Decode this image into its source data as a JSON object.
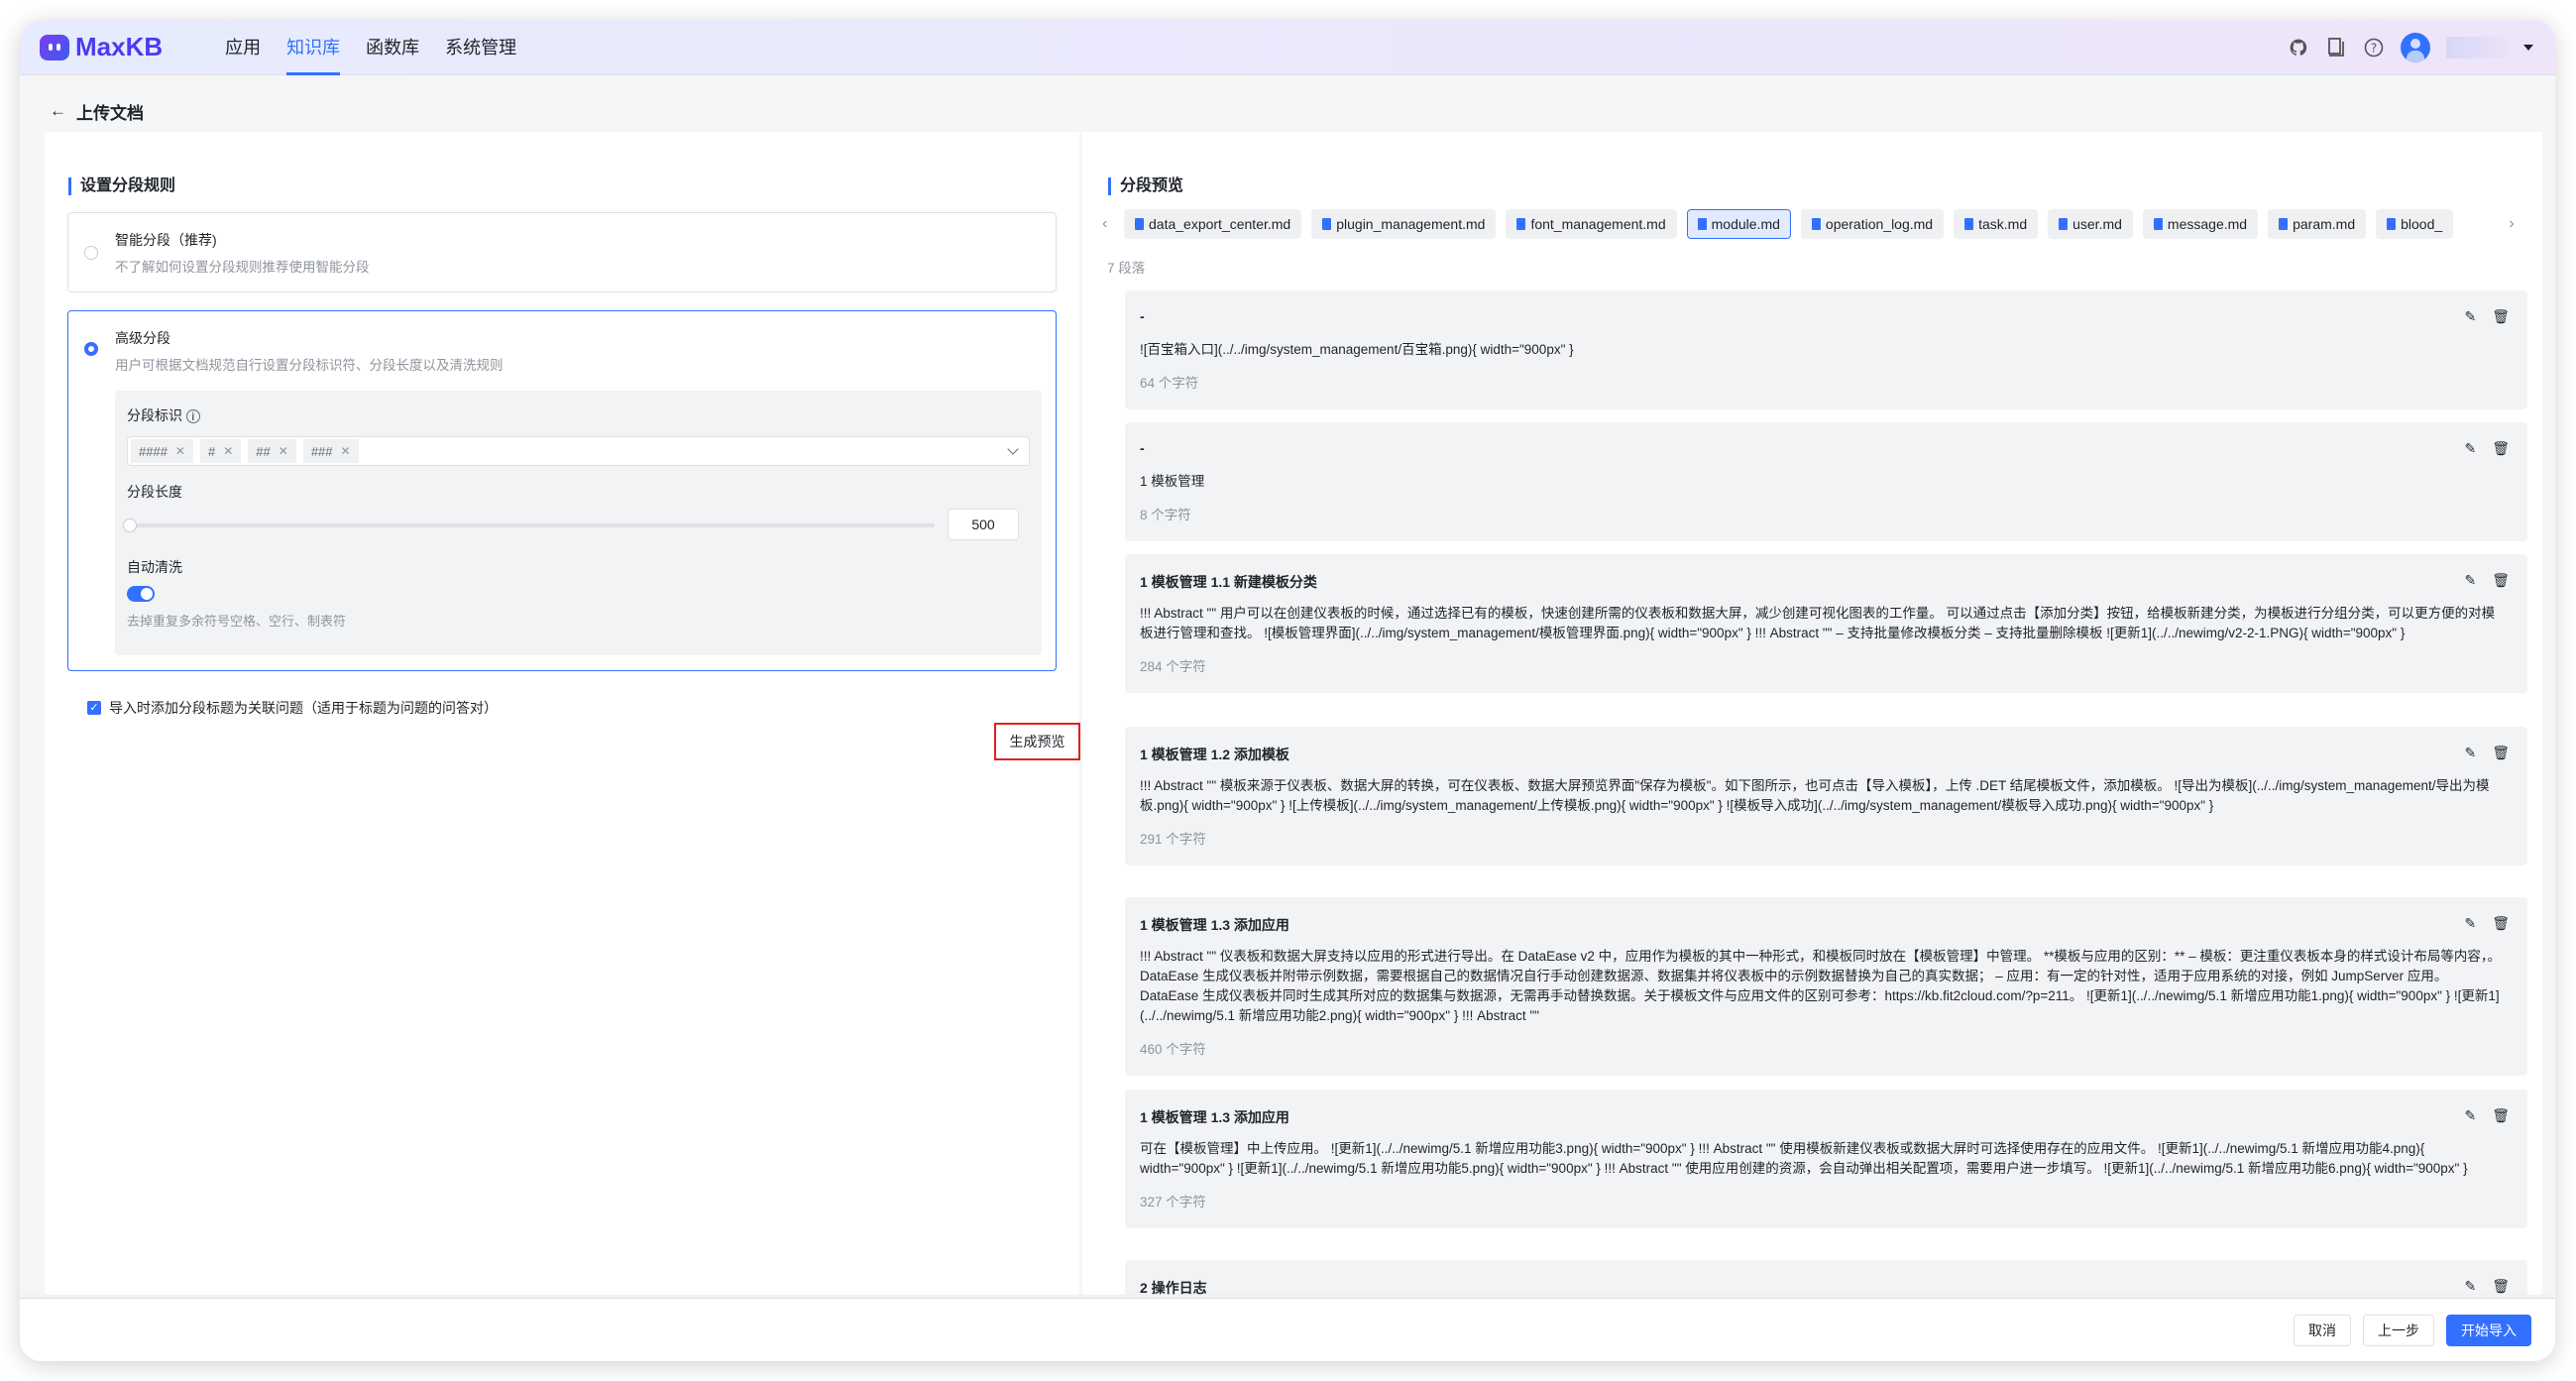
{
  "header": {
    "logo": "MaxKB",
    "nav": [
      "应用",
      "知识库",
      "函数库",
      "系统管理"
    ],
    "active_nav": 1,
    "icons": [
      "github-icon",
      "book-icon",
      "help-icon"
    ]
  },
  "page": {
    "title": "上传文档"
  },
  "left": {
    "title": "设置分段规则",
    "smart": {
      "title": "智能分段（推荐)",
      "desc": "不了解如何设置分段规则推荐使用智能分段",
      "selected": false
    },
    "advanced": {
      "title": "高级分段",
      "desc": "用户可根据文档规范自行设置分段标识符、分段长度以及清洗规则",
      "selected": true,
      "marker_label": "分段标识",
      "markers": [
        "####",
        "#",
        "##",
        "###"
      ],
      "length_label": "分段长度",
      "length_value": "500",
      "clean_label": "自动清洗",
      "clean_on": true,
      "clean_desc": "去掉重复多余符号空格、空行、制表符"
    },
    "checkbox": {
      "label": "导入时添加分段标题为关联问题（适用于标题为问题的问答对）",
      "checked": true
    },
    "generate_btn": "生成预览"
  },
  "right": {
    "title": "分段预览",
    "files": [
      "data_export_center.md",
      "plugin_management.md",
      "font_management.md",
      "module.md",
      "operation_log.md",
      "task.md",
      "user.md",
      "message.md",
      "param.md",
      "blood_"
    ],
    "active_file": 3,
    "count": "7 段落",
    "paragraphs": [
      {
        "title": "-",
        "body": "![百宝箱入口](../../img/system_management/百宝箱.png){ width=\"900px\" }",
        "chars": "64 个字符"
      },
      {
        "title": "-",
        "body": "1 模板管理",
        "chars": "8 个字符"
      },
      {
        "title": "1 模板管理 1.1 新建模板分类",
        "body": "!!! Abstract \"\" 用户可以在创建仪表板的时候，通过选择已有的模板，快速创建所需的仪表板和数据大屏，减少创建可视化图表的工作量。 可以通过点击【添加分类】按钮，给模板新建分类，为模板进行分组分类，可以更方便的对模板进行管理和查找。 ![模板管理界面](../../img/system_management/模板管理界面.png){ width=\"900px\" } !!! Abstract \"\" – 支持批量修改模板分类 – 支持批量删除模板 ![更新1](../../newimg/v2-2-1.PNG){ width=\"900px\" }",
        "chars": "284 个字符"
      },
      {
        "title": "1 模板管理 1.2 添加模板",
        "body": "!!! Abstract \"\" 模板来源于仪表板、数据大屏的转换，可在仪表板、数据大屏预览界面\"保存为模板\"。如下图所示，也可点击【导入模板】，上传 .DET 结尾模板文件，添加模板。 ![导出为模板](../../img/system_management/导出为模板.png){ width=\"900px\" } ![上传模板](../../img/system_management/上传模板.png){ width=\"900px\" } ![模板导入成功](../../img/system_management/模板导入成功.png){ width=\"900px\" }",
        "chars": "291 个字符"
      },
      {
        "title": "1 模板管理 1.3 添加应用",
        "body": "!!! Abstract \"\" 仪表板和数据大屏支持以应用的形式进行导出。在 DataEase v2 中，应用作为模板的其中一种形式，和模板同时放在【模板管理】中管理。 **模板与应用的区别：** – 模板：更注重仪表板本身的样式设计布局等内容，。DataEase 生成仪表板并附带示例数据，需要根据自己的数据情况自行手动创建数据源、数据集并将仪表板中的示例数据替换为自己的真实数据； – 应用：有一定的针对性，适用于应用系统的对接，例如 JumpServer 应用。DataEase 生成仪表板并同时生成其所对应的数据集与数据源，无需再手动替换数据。关于模板文件与应用文件的区别可参考：https://kb.fit2cloud.com/?p=211。 ![更新1](../../newimg/5.1 新增应用功能1.png){ width=\"900px\" } ![更新1](../../newimg/5.1 新增应用功能2.png){ width=\"900px\" } !!! Abstract \"\"",
        "chars": "460 个字符"
      },
      {
        "title": "1 模板管理 1.3 添加应用",
        "body": "可在【模板管理】中上传应用。 ![更新1](../../newimg/5.1 新增应用功能3.png){ width=\"900px\" } !!! Abstract \"\" 使用模板新建仪表板或数据大屏时可选择使用存在的应用文件。 ![更新1](../../newimg/5.1 新增应用功能4.png){ width=\"900px\" } ![更新1](../../newimg/5.1 新增应用功能5.png){ width=\"900px\" } !!! Abstract \"\" 使用应用创建的资源，会自动弹出相关配置项，需要用户进一步填写。 ![更新1](../../newimg/5.1 新增应用功能6.png){ width=\"900px\" }",
        "chars": "327 个字符"
      },
      {
        "title": "2 操作日志",
        "body": "",
        "chars": ""
      }
    ]
  },
  "footer": {
    "cancel": "取消",
    "prev": "上一步",
    "start": "开始导入"
  },
  "colors": {
    "accent": "#3370ff",
    "highlight_border": "#e02020"
  }
}
